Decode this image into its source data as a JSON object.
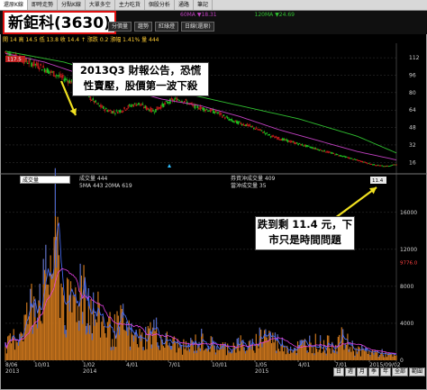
{
  "tabs": [
    "還原K線",
    "即時走勢",
    "分點K線",
    "大單多空",
    "主力吃貨",
    "個股分析",
    "通路",
    "筆記"
  ],
  "stock_title": "新鉅科(3630)",
  "controls": {
    "period": "日線(還原)",
    "buttons": [
      "分價量",
      "趨勢",
      "紅綠燈"
    ]
  },
  "ma_legend": {
    "ma60": "60MA ▼18.31",
    "ma120": "120MA ▼24.69"
  },
  "quote_row": "開 14  高 14.5  低 13.8  收 14.4  ↑ 漲跌 0.2  漲幅 1.41%  量 444",
  "volume_panel": {
    "select_label": "成交量",
    "legend_left": [
      "成交量 444",
      "5MA 443   20MA 619"
    ],
    "legend_right": [
      "券資沖成交量 409",
      "當沖成交量 35"
    ]
  },
  "callouts": {
    "top": [
      "2013Q3 財報公告，恐慌",
      "性賣壓，股價第一波下殺"
    ],
    "bottom": [
      "跌到剩 11.4 元，下",
      "市只是時間問題"
    ]
  },
  "price_box_label": "117.5",
  "last_price_label": "11.4",
  "volume_marker_label": "9776.0",
  "nav_buttons": [
    "日",
    "週",
    "月",
    "季",
    "年",
    "全部",
    "範圍"
  ],
  "colors": {
    "candle_up": "#e02020",
    "candle_down": "#20c020",
    "ma60": "#c040c0",
    "ma120": "#30c030",
    "volume": "#c8741c",
    "volume_accent": "#3060e0",
    "callout_arrow": "#f0e020"
  },
  "chart_data": {
    "type": "line",
    "title": "新鉅科(3630)",
    "price_axis": {
      "ticks": [
        112,
        96,
        80,
        64,
        48,
        32,
        16
      ],
      "ylim": [
        8,
        122
      ]
    },
    "volume_axis": {
      "ticks": [
        16000,
        12000,
        8000,
        4000,
        0
      ],
      "ylim": [
        0,
        19000
      ]
    },
    "x_tick_labels": [
      "8/06\n2013",
      "10/01",
      "1/02\n2014",
      "4/01",
      "7/01",
      "10/01",
      "1/05\n2015",
      "4/01",
      "7/01",
      "2015/09/02"
    ],
    "price_path": [
      [
        0,
        117
      ],
      [
        3,
        112
      ],
      [
        6,
        108
      ],
      [
        9,
        104
      ],
      [
        12,
        98
      ],
      [
        15,
        93
      ],
      [
        18,
        88
      ],
      [
        20,
        82
      ],
      [
        22,
        74
      ],
      [
        24,
        68
      ],
      [
        26,
        64
      ],
      [
        28,
        62
      ],
      [
        30,
        64
      ],
      [
        32,
        68
      ],
      [
        34,
        70
      ],
      [
        36,
        66
      ],
      [
        38,
        63
      ],
      [
        40,
        68
      ],
      [
        42,
        72
      ],
      [
        44,
        74
      ],
      [
        46,
        72
      ],
      [
        48,
        68
      ],
      [
        50,
        66
      ],
      [
        52,
        64
      ],
      [
        54,
        62
      ],
      [
        56,
        58
      ],
      [
        58,
        54
      ],
      [
        60,
        52
      ],
      [
        62,
        50
      ],
      [
        64,
        47
      ],
      [
        66,
        44
      ],
      [
        68,
        40
      ],
      [
        70,
        38
      ],
      [
        72,
        36
      ],
      [
        74,
        34
      ],
      [
        76,
        32
      ],
      [
        78,
        30
      ],
      [
        80,
        28
      ],
      [
        82,
        26
      ],
      [
        84,
        24
      ],
      [
        86,
        22
      ],
      [
        88,
        20
      ],
      [
        90,
        18
      ],
      [
        92,
        16
      ],
      [
        94,
        14
      ],
      [
        96,
        13
      ],
      [
        98,
        12.5
      ],
      [
        100,
        14.4
      ]
    ],
    "ma60_path": [
      [
        0,
        116
      ],
      [
        10,
        108
      ],
      [
        20,
        96
      ],
      [
        30,
        84
      ],
      [
        40,
        74
      ],
      [
        50,
        68
      ],
      [
        60,
        58
      ],
      [
        70,
        46
      ],
      [
        80,
        36
      ],
      [
        90,
        26
      ],
      [
        100,
        18.3
      ]
    ],
    "ma120_path": [
      [
        0,
        118
      ],
      [
        15,
        108
      ],
      [
        30,
        92
      ],
      [
        45,
        80
      ],
      [
        60,
        68
      ],
      [
        75,
        56
      ],
      [
        90,
        40
      ],
      [
        100,
        24.7
      ]
    ],
    "volume_profile": [
      [
        0,
        1500
      ],
      [
        3,
        3000
      ],
      [
        6,
        5500
      ],
      [
        8,
        9000
      ],
      [
        10,
        8000
      ],
      [
        12,
        12500
      ],
      [
        13,
        15000
      ],
      [
        14,
        9500
      ],
      [
        16,
        6000
      ],
      [
        18,
        7500
      ],
      [
        20,
        10500
      ],
      [
        22,
        6000
      ],
      [
        24,
        5000
      ],
      [
        26,
        4000
      ],
      [
        28,
        3500
      ],
      [
        30,
        4500
      ],
      [
        32,
        3000
      ],
      [
        35,
        2500
      ],
      [
        38,
        3800
      ],
      [
        40,
        2500
      ],
      [
        43,
        2000
      ],
      [
        46,
        1500
      ],
      [
        50,
        2500
      ],
      [
        53,
        1800
      ],
      [
        56,
        1500
      ],
      [
        60,
        2000
      ],
      [
        63,
        1500
      ],
      [
        66,
        3500
      ],
      [
        70,
        2000
      ],
      [
        74,
        1500
      ],
      [
        78,
        2200
      ],
      [
        82,
        1800
      ],
      [
        86,
        2500
      ],
      [
        90,
        1200
      ],
      [
        94,
        1000
      ],
      [
        97,
        800
      ],
      [
        100,
        444
      ]
    ]
  }
}
